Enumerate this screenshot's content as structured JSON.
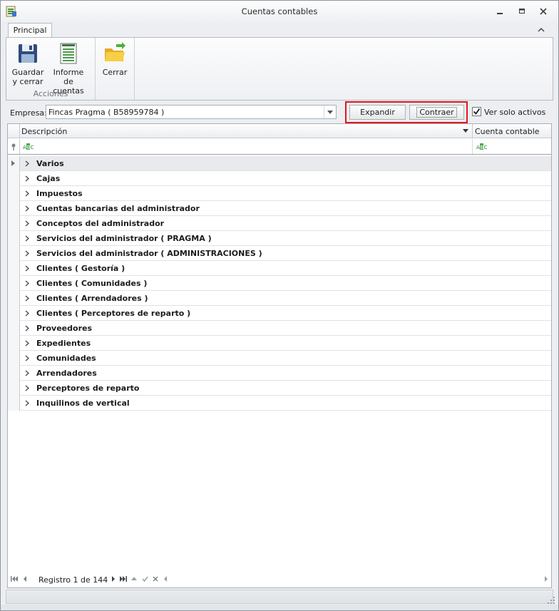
{
  "window": {
    "title": "Cuentas contables"
  },
  "ribbon": {
    "tab": "Principal",
    "groups": {
      "acciones": {
        "label": "Acciones",
        "buttons": {
          "guardar_line1": "Guardar",
          "guardar_line2": "y cerrar",
          "informe_line1": "Informe de",
          "informe_line2": "cuentas"
        }
      },
      "cerrar": {
        "button": "Cerrar"
      }
    }
  },
  "filter": {
    "empresa_label": "Empresa:",
    "empresa_value": "Fincas Pragma ( B58959784 )",
    "expand_label": "Expandir",
    "collapse_label": "Contraer",
    "active_only_label": "Ver solo activos",
    "active_only_checked": true,
    "highlight_color": "#e1161b"
  },
  "grid": {
    "columns": [
      "Descripción",
      "Cuenta contable"
    ],
    "rows": [
      "Varios",
      "Cajas",
      "Impuestos",
      "Cuentas bancarias del administrador",
      "Conceptos del administrador",
      "Servicios del administrador ( PRAGMA )",
      "Servicios del administrador ( ADMINISTRACIONES )",
      "Clientes ( Gestoría )",
      "Clientes ( Comunidades )",
      "Clientes ( Arrendadores )",
      "Clientes ( Perceptores de reparto )",
      "Proveedores",
      "Expedientes",
      "Comunidades",
      "Arrendadores",
      "Perceptores de reparto",
      "Inquilinos de vertical"
    ],
    "navigator": "Registro 1 de 144"
  }
}
